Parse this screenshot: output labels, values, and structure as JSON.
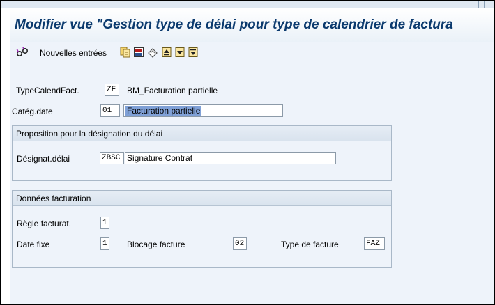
{
  "title": "Modifier vue \"Gestion type de délai pour type de calendrier de factura",
  "toolbar": {
    "new_entries_label": "Nouvelles entrées",
    "icons": [
      "display-change-icon",
      "copy-icon",
      "delete-icon",
      "undo-icon",
      "first-entry-icon",
      "previous-entry-icon",
      "next-entry-icon"
    ]
  },
  "header": {
    "calendar_type_label": "TypeCalendFact.",
    "calendar_type_value": "ZF",
    "calendar_type_desc": "BM_Facturation partielle",
    "date_category_label": "Catég.date",
    "date_category_value": "01",
    "date_category_desc": "Facturation partielle"
  },
  "proposal_group": {
    "title": "Proposition pour la désignation du délai",
    "designation_label": "Désignat.délai",
    "designation_code": "ZBSC",
    "designation_text": "Signature Contrat"
  },
  "billing_group": {
    "title": "Données facturation",
    "billing_rule_label": "Règle facturat.",
    "billing_rule_value": "1",
    "fixed_date_label": "Date fixe",
    "fixed_date_value": "1",
    "billing_block_label": "Blocage facture",
    "billing_block_value": "02",
    "invoice_type_label": "Type de facture",
    "invoice_type_value": "FAZ"
  },
  "colors": {
    "title": "#0b3a6e",
    "background": "#eef3fa",
    "highlight": "#7fa0d6"
  }
}
